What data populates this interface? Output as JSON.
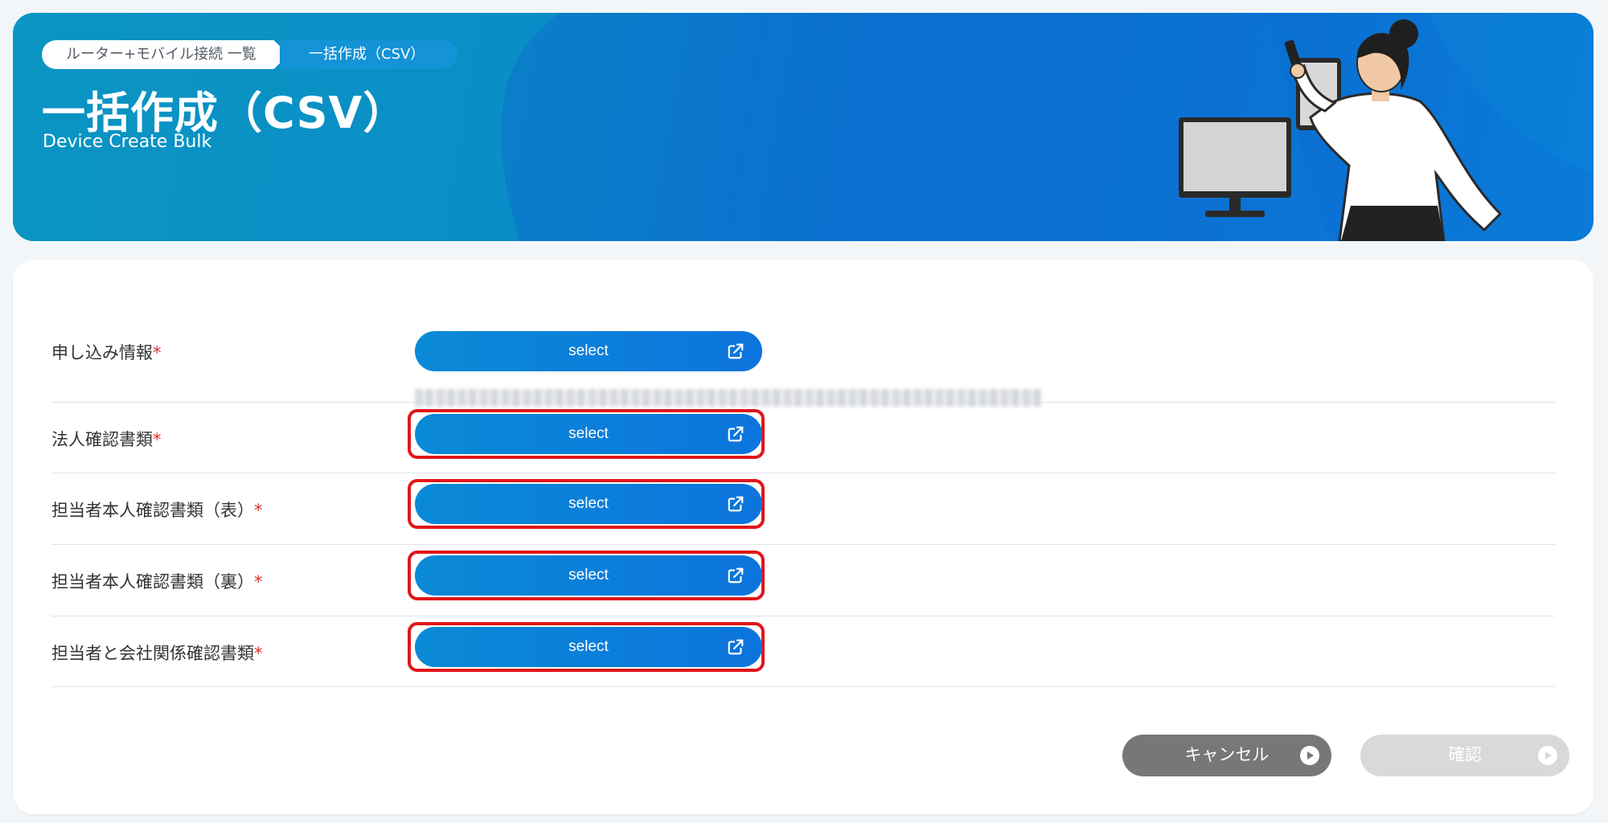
{
  "header": {
    "breadcrumb": [
      {
        "label": "ルーター+モバイル接続 一覧"
      },
      {
        "label": "一括作成（CSV）"
      }
    ],
    "title": "一括作成（CSV）",
    "subtitle": "Device Create Bulk"
  },
  "form": {
    "rows": [
      {
        "label": "申し込み情報",
        "required_mark": "*",
        "button_label": "select",
        "highlighted": false,
        "has_blurred_detail": true
      },
      {
        "label": "法人確認書類",
        "required_mark": "*",
        "button_label": "select",
        "highlighted": true
      },
      {
        "label": "担当者本人確認書類（表）",
        "required_mark": "*",
        "button_label": "select",
        "highlighted": true
      },
      {
        "label": "担当者本人確認書類（裏）",
        "required_mark": "*",
        "button_label": "select",
        "highlighted": true
      },
      {
        "label": "担当者と会社関係確認書類",
        "required_mark": "*",
        "button_label": "select",
        "highlighted": true
      }
    ]
  },
  "actions": {
    "cancel_label": "キャンセル",
    "confirm_label": "確認",
    "confirm_enabled": false
  },
  "colors": {
    "banner_primary": "#0a6fd0",
    "select_button": "#0c74dd",
    "highlight_border": "#e0161a",
    "cancel_button": "#777777",
    "confirm_disabled": "#d9d9d9",
    "required_mark": "#e03030"
  },
  "icons": {
    "select_button_icon": "external-link-icon",
    "action_button_icon": "play-circle-icon"
  }
}
